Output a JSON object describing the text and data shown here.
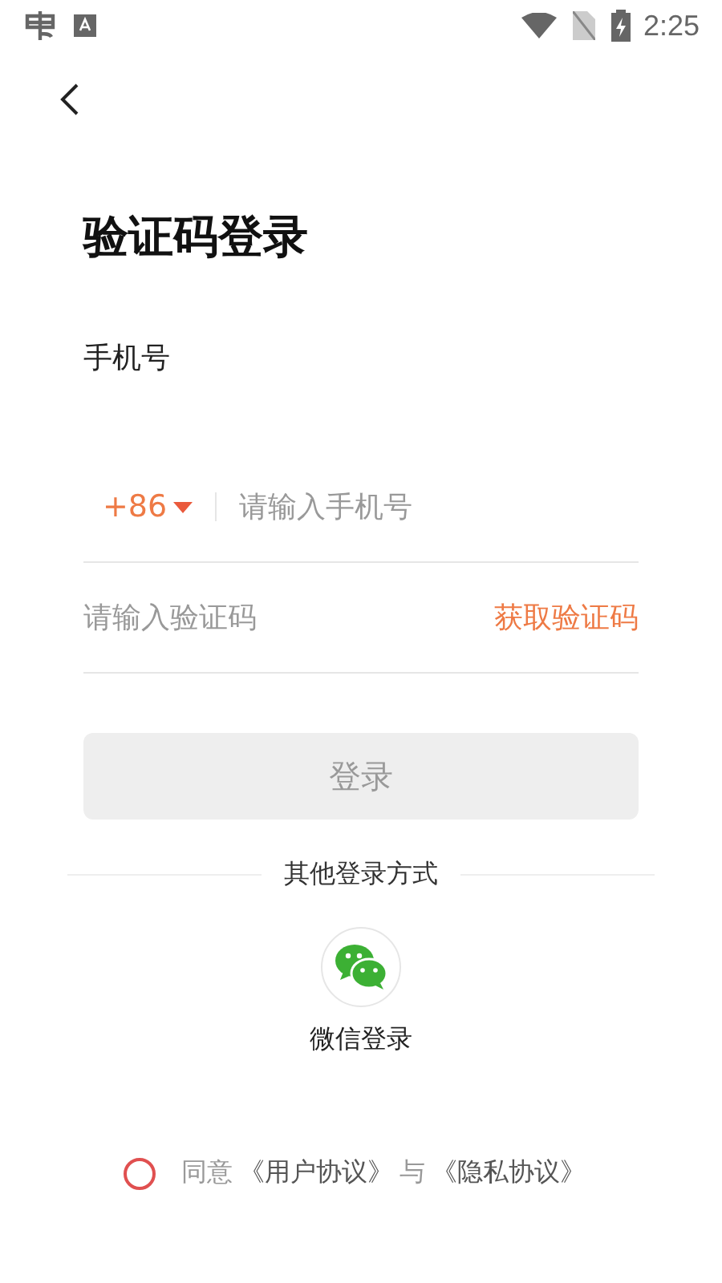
{
  "status_bar": {
    "time": "2:25"
  },
  "title": "验证码登录",
  "phone_label": "手机号",
  "phone": {
    "country_code": "+86",
    "placeholder": "请输入手机号"
  },
  "code": {
    "placeholder": "请输入验证码",
    "get_code": "获取验证码"
  },
  "login_button": {
    "label": "登录",
    "disabled": true
  },
  "other_login": {
    "label": "其他登录方式",
    "options": [
      {
        "kind": "wechat",
        "label": "微信登录"
      }
    ]
  },
  "agreement": {
    "checked": false,
    "parts": [
      {
        "kind": "text",
        "text": "同意"
      },
      {
        "kind": "link",
        "text": "《用户协议》"
      },
      {
        "kind": "text",
        "text": "与"
      },
      {
        "kind": "link",
        "text": "《隐私协议》"
      }
    ]
  }
}
